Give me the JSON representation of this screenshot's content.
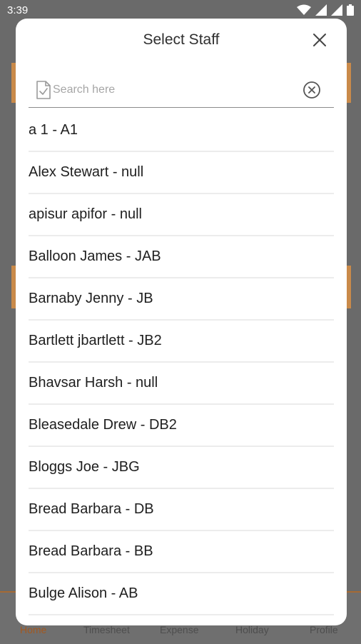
{
  "status_bar": {
    "time": "3:39"
  },
  "background": {
    "nav": [
      "Home",
      "Timesheet",
      "Expense",
      "Holiday",
      "Profile"
    ]
  },
  "modal": {
    "title": "Select Staff",
    "search": {
      "placeholder": "Search here",
      "value": ""
    },
    "staff": [
      "a 1 - A1",
      "Alex Stewart - null",
      "apisur apifor - null",
      "Balloon James - JAB",
      "Barnaby Jenny - JB",
      "Bartlett jbartlett - JB2",
      "Bhavsar Harsh - null",
      "Bleasedale Drew - DB2",
      "Bloggs Joe - JBG",
      "Bread Barbara - DB",
      "Bread Barbara - BB",
      "Bulge Alison - AB"
    ]
  }
}
